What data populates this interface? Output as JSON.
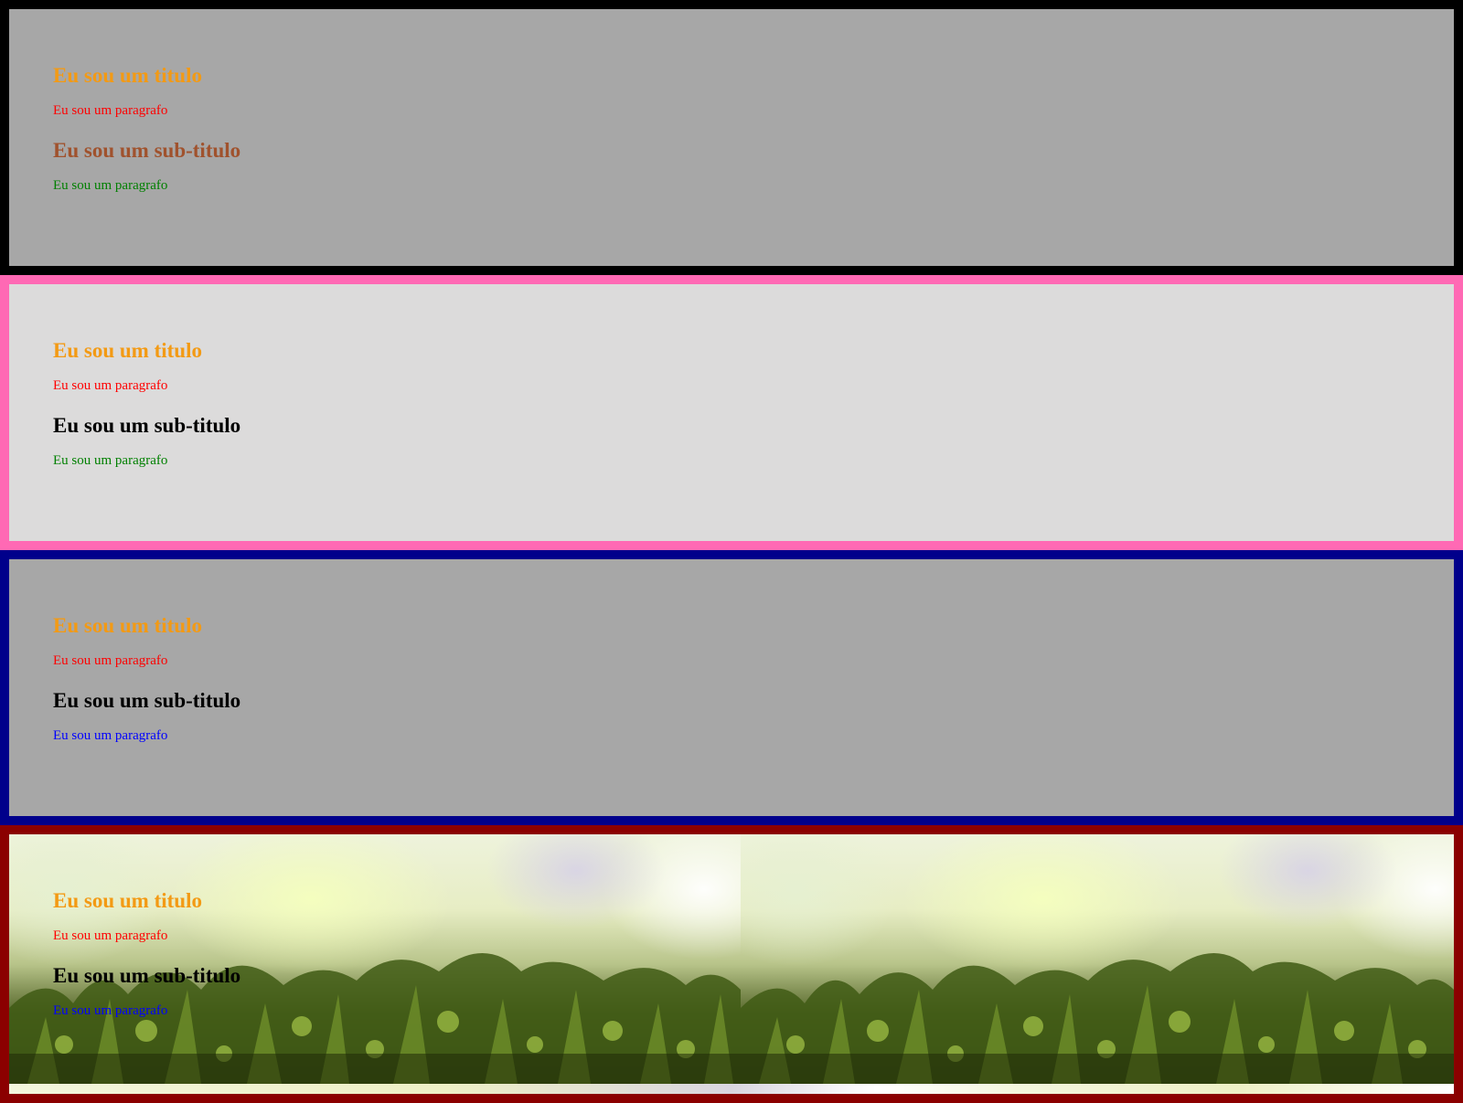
{
  "colors": {
    "title": "#f39a14",
    "para_red": "#ff0000",
    "subtitle_brown": "#a0522d",
    "subtitle_black": "#000000",
    "para_green": "#008000",
    "para_blue": "#0000ff"
  },
  "sections": [
    {
      "title": "Eu sou um titulo",
      "paragraph1": "Eu sou um paragrafo",
      "subtitle": "Eu sou um sub-titulo",
      "paragraph2": "Eu sou um paragrafo"
    },
    {
      "title": "Eu sou um titulo",
      "paragraph1": "Eu sou um paragrafo",
      "subtitle": "Eu sou um sub-titulo",
      "paragraph2": "Eu sou um paragrafo"
    },
    {
      "title": "Eu sou um titulo",
      "paragraph1": "Eu sou um paragrafo",
      "subtitle": "Eu sou um sub-titulo",
      "paragraph2": "Eu sou um paragrafo"
    },
    {
      "title": "Eu sou um titulo",
      "paragraph1": "Eu sou um paragrafo",
      "subtitle": "Eu sou um sub-titulo",
      "paragraph2": "Eu sou um paragrafo",
      "background_image": "moss-photo"
    }
  ]
}
